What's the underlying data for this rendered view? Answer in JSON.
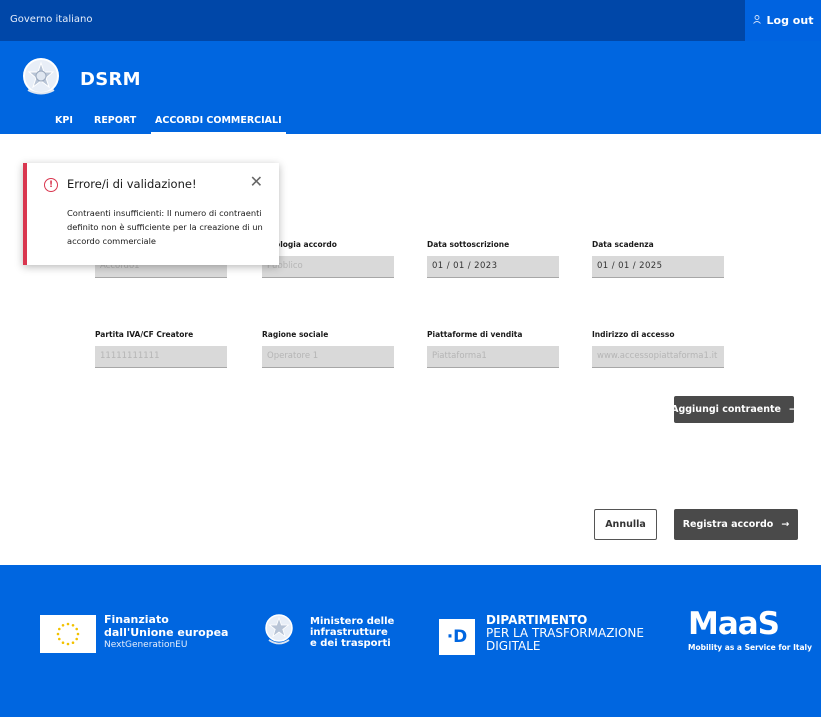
{
  "topbar": {
    "gov_label": "Governo italiano",
    "logout_label": "Log out",
    "user_icon": "user-icon"
  },
  "header": {
    "brand": "DSRM",
    "tabs": [
      {
        "label": "KPI",
        "active": false
      },
      {
        "label": "REPORT",
        "active": false
      },
      {
        "label": "ACCORDI COMMERCIALI",
        "active": true
      }
    ]
  },
  "alert": {
    "title": "Errore/i di validazione!",
    "message": "Contraenti insufficienti: Il numero di contraenti definito non è sufficiente per la creazione di un accordo commerciale",
    "icon": "!",
    "close_icon": "✕"
  },
  "form": {
    "row1": [
      {
        "label": "",
        "value": "Accordo1"
      },
      {
        "label": "Tipologia accordo",
        "value": "Pubblico"
      },
      {
        "label": "Data sottoscrizione",
        "value": "01 / 01 / 2023"
      },
      {
        "label": "Data scadenza",
        "value": "01 / 01 / 2025"
      }
    ],
    "row2": [
      {
        "label": "Partita IVA/CF Creatore",
        "value": "11111111111"
      },
      {
        "label": "Ragione sociale",
        "value": "Operatore 1"
      },
      {
        "label": "Piattaforme di vendita",
        "value": "Piattaforma1"
      },
      {
        "label": "Indirizzo  di accesso",
        "value": "www.accessopiattaforma1.it"
      }
    ]
  },
  "buttons": {
    "add_contractor": "Aggiungi contraente",
    "cancel": "Annulla",
    "register": "Registra accordo",
    "arrow": "→"
  },
  "footer": {
    "eu_line1": "Finanziato",
    "eu_line2": "dall'Unione europea",
    "eu_line3": "NextGenerationEU",
    "ministry_line1": "Ministero delle",
    "ministry_line2": "infrastrutture",
    "ministry_line3": "e dei trasporti",
    "dtd_mark": "·D",
    "dtd_line1": "DIPARTIMENTO",
    "dtd_line2": "PER LA TRASFORMAZIONE",
    "dtd_line3": "DIGITALE",
    "maas_logo": "MaaS",
    "maas_tagline": "Mobility as a Service for Italy"
  },
  "colors": {
    "primary": "#0066e0",
    "topbar": "#0047a8",
    "error": "#d9364f",
    "button_dark": "#4a4a4a",
    "field_bg": "#d9d9d9"
  }
}
